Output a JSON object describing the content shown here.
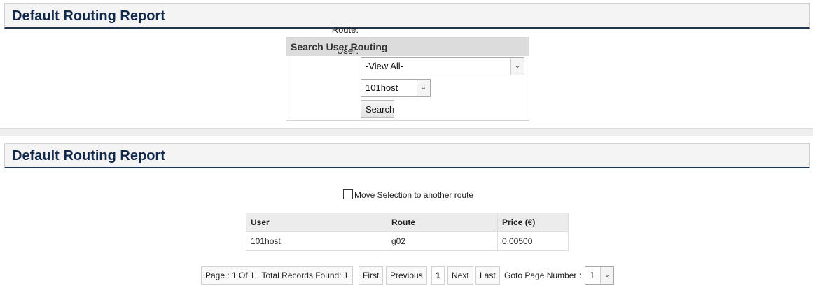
{
  "top_header": {
    "title": "Default Routing Report"
  },
  "search": {
    "title": "Search User Routing",
    "route_label": "Route:",
    "route_value": "-View All-",
    "user_label": "User:",
    "user_value": "101host",
    "button_label": "Search"
  },
  "report_header": {
    "title": "Default Routing Report"
  },
  "move_selection": {
    "label": "Move Selection to another route",
    "checked": false
  },
  "table": {
    "headers": [
      "User",
      "Route",
      "Price (€)"
    ],
    "rows": [
      [
        "101host",
        "g02",
        "0.00500"
      ]
    ]
  },
  "pager": {
    "summary": "Page : 1 Of 1 . Total Records Found: 1",
    "first": "First",
    "previous": "Previous",
    "current": "1",
    "next": "Next",
    "last": "Last",
    "goto_label": "Goto Page Number :",
    "goto_value": "1"
  }
}
